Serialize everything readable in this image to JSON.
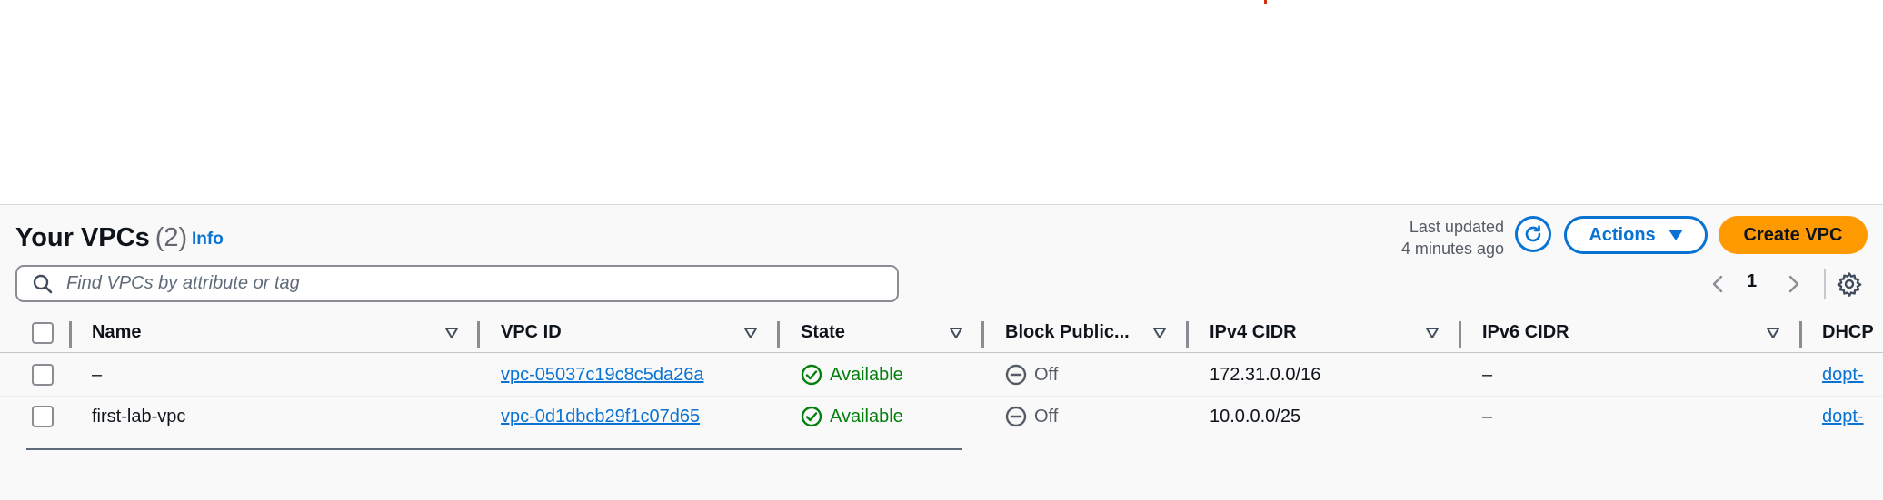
{
  "header": {
    "title": "Your VPCs",
    "count": "(2)",
    "info_label": "Info",
    "last_updated_line1": "Last updated",
    "last_updated_line2": "4 minutes ago",
    "actions_label": "Actions",
    "create_label": "Create VPC"
  },
  "search": {
    "placeholder": "Find VPCs by attribute or tag"
  },
  "pagination": {
    "current_page": "1"
  },
  "table": {
    "columns": [
      "Name",
      "VPC ID",
      "State",
      "Block Public...",
      "IPv4 CIDR",
      "IPv6 CIDR",
      "DHCP"
    ],
    "rows": [
      {
        "name": "–",
        "vpc_id": "vpc-05037c19c8c5da26a",
        "state": "Available",
        "block_public": "Off",
        "ipv4_cidr": "172.31.0.0/16",
        "ipv6_cidr": "–",
        "dhcp": "dopt-"
      },
      {
        "name": "first-lab-vpc",
        "vpc_id": "vpc-0d1dbcb29f1c07d65",
        "state": "Available",
        "block_public": "Off",
        "ipv4_cidr": "10.0.0.0/25",
        "ipv6_cidr": "–",
        "dhcp": "dopt-"
      }
    ]
  },
  "colors": {
    "accent": "#0972d3",
    "primary_button": "#ff9900",
    "success": "#037f0c"
  }
}
